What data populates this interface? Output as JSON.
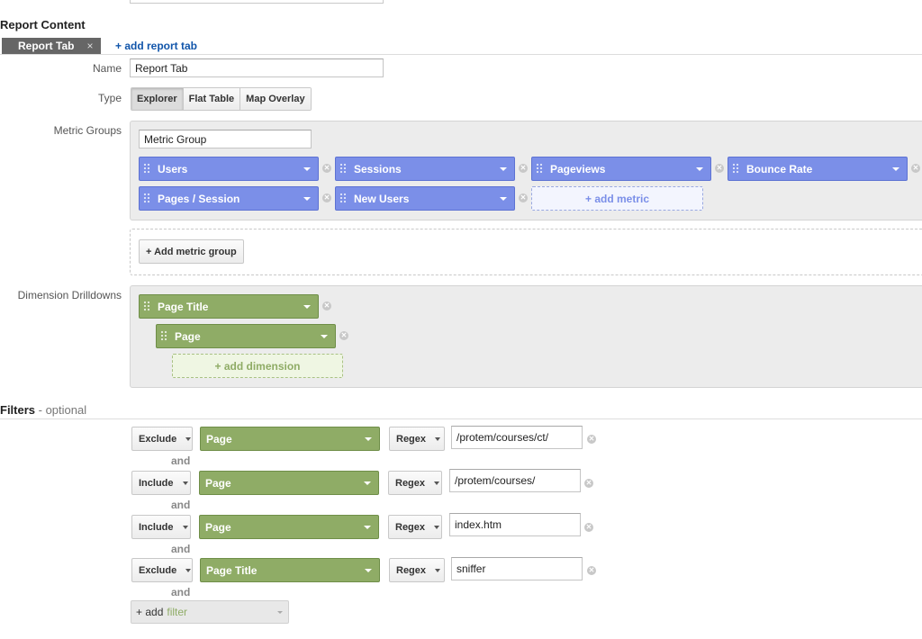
{
  "report_content": {
    "title": "Report Content",
    "tab_label": "Report Tab",
    "tab_close": "×",
    "add_tab": "+ add report tab",
    "name_label": "Name",
    "name_value": "Report Tab",
    "type_label": "Type",
    "types": [
      "Explorer",
      "Flat Table",
      "Map Overlay"
    ],
    "selected_type": "Explorer"
  },
  "metric_groups": {
    "label": "Metric Groups",
    "group_name": "Metric Group",
    "metrics": [
      "Users",
      "Sessions",
      "Pageviews",
      "Bounce Rate",
      "Pages / Session",
      "New Users"
    ],
    "add_metric": "+ add metric",
    "add_group": "+ Add metric group"
  },
  "dimensions": {
    "label": "Dimension Drilldowns",
    "items": [
      "Page Title",
      "Page"
    ],
    "add_dimension": "+ add dimension"
  },
  "filters": {
    "title": "Filters",
    "optional": " - optional",
    "joiner": "and",
    "rows": [
      {
        "mode": "Exclude",
        "dimension": "Page",
        "match": "Regex",
        "value": "/protem/courses/ct/"
      },
      {
        "mode": "Include",
        "dimension": "Page",
        "match": "Regex",
        "value": "/protem/courses/"
      },
      {
        "mode": "Include",
        "dimension": "Page",
        "match": "Regex",
        "value": "index.htm"
      },
      {
        "mode": "Exclude",
        "dimension": "Page Title",
        "match": "Regex",
        "value": "sniffer"
      }
    ],
    "add_filter_prefix": "+ add",
    "add_filter_word": "filter"
  },
  "colors": {
    "metric_chip": "#7b8fe8",
    "dimension_chip": "#8fac66",
    "link": "#1155aa"
  }
}
